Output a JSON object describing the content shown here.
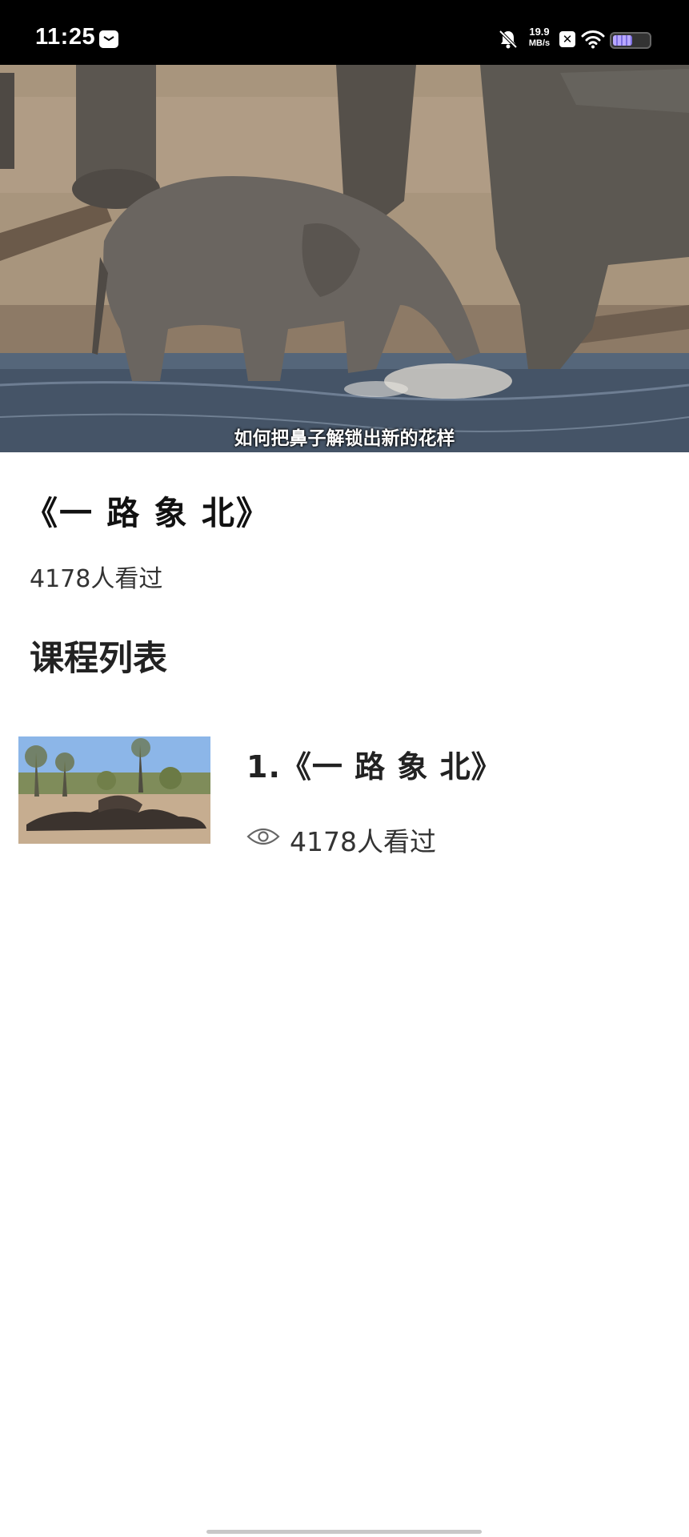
{
  "status_bar": {
    "time": "11:25",
    "speed_value": "19.9",
    "speed_unit": "MB/s",
    "icons": [
      "message-icon",
      "mute-bell-icon",
      "x-app-icon",
      "wifi-icon",
      "battery-icon"
    ],
    "battery_level": 0.55
  },
  "video": {
    "subtitle": "如何把鼻子解锁出新的花样"
  },
  "course": {
    "title": "《一 路 象 北》",
    "viewers": "4178人看过"
  },
  "section": {
    "title": "课程列表"
  },
  "lessons": [
    {
      "title": "1.《一 路 象 北》",
      "views": "4178人看过",
      "thumb_caption": "",
      "icon": "eye-icon"
    }
  ],
  "colors": {
    "status_bar_bg": "#000000",
    "page_bg": "#ffffff",
    "text_primary": "#222222"
  }
}
